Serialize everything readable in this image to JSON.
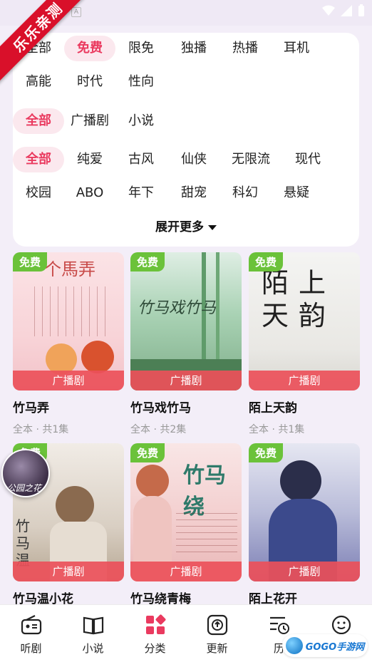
{
  "ribbon": {
    "label": "乐乐亲测"
  },
  "status_bar": {
    "a_icon": "A"
  },
  "filters": {
    "row1": [
      "全部",
      "免费",
      "限免",
      "独播",
      "热播",
      "耳机"
    ],
    "row2": [
      "高能",
      "时代",
      "性向"
    ],
    "row3": [
      "全部",
      "广播剧",
      "小说"
    ],
    "row4": [
      "全部",
      "纯爱",
      "古风",
      "仙侠",
      "无限流",
      "现代"
    ],
    "row5": [
      "校园",
      "ABO",
      "年下",
      "甜宠",
      "科幻",
      "悬疑"
    ],
    "expand_label": "展开更多"
  },
  "cards": [
    {
      "title": "竹马弄",
      "meta": "全本 · 共1集",
      "badge": "免费",
      "tag": "广播剧",
      "cover_text": "个馬弄"
    },
    {
      "title": "竹马戏竹马",
      "meta": "全本 · 共2集",
      "badge": "免费",
      "tag": "广播剧",
      "cover_text": "竹马戏竹马"
    },
    {
      "title": "陌上天韵",
      "meta": "全本 · 共1集",
      "badge": "免费",
      "tag": "广播剧",
      "cover_text": "陌上天韵"
    },
    {
      "title": "竹马温小花",
      "meta": "",
      "badge": "免费",
      "tag": "广播剧",
      "cover_text": "竹马温"
    },
    {
      "title": "竹马绕青梅",
      "meta": "",
      "badge": "免费",
      "tag": "广播剧",
      "cover_text": "竹马绕"
    },
    {
      "title": "陌上花开",
      "meta": "",
      "badge": "免费",
      "tag": "广播剧",
      "cover_text": ""
    }
  ],
  "float_avatar": {
    "text": "公园之花"
  },
  "bottom_nav": [
    {
      "label": "听剧",
      "icon": "radio-icon"
    },
    {
      "label": "小说",
      "icon": "book-icon"
    },
    {
      "label": "分类",
      "icon": "category-icon"
    },
    {
      "label": "更新",
      "icon": "update-icon"
    },
    {
      "label": "历",
      "icon": "history-icon"
    },
    {
      "label": "",
      "icon": "smile-icon"
    }
  ],
  "watermark": {
    "text": "GOGO手游网"
  },
  "colors": {
    "accent": "#ea3a5f",
    "free_badge": "#6bc23a",
    "tag_bar": "#eb505a"
  }
}
